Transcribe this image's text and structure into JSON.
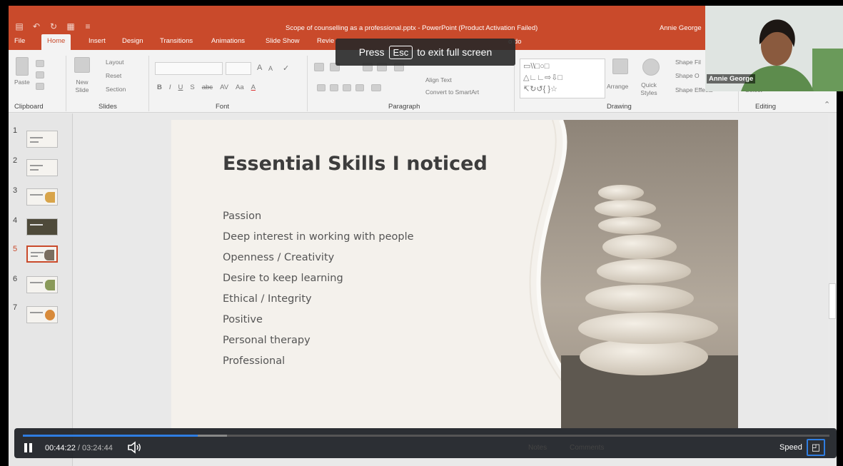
{
  "window": {
    "title": "Scope of counselling as a professional.pptx  -  PowerPoint (Product Activation Failed)",
    "user": "Annie George"
  },
  "tabs": [
    "File",
    "Home",
    "Insert",
    "Design",
    "Transitions",
    "Animations",
    "Slide Show",
    "Revie"
  ],
  "active_tab": "Home",
  "tell_me_fragment": "o do",
  "ribbon": {
    "groups": [
      "Clipboard",
      "Slides",
      "Font",
      "Paragraph",
      "Drawing",
      "Editing"
    ],
    "clipboard": {
      "paste": "Paste"
    },
    "slides": {
      "new_slide": "New Slide",
      "layout": "Layout",
      "reset": "Reset",
      "section": "Section"
    },
    "font": {
      "grow": "A",
      "shrink": "A",
      "case": "Aa",
      "color": "A",
      "format_marks": [
        "B",
        "I",
        "U",
        "S",
        "abc",
        "AV"
      ]
    },
    "paragraph": {
      "align_text": "Align Text",
      "convert_smartart": "Convert to SmartArt"
    },
    "drawing": {
      "arrange": "Arrange",
      "quick_styles": "Quick Styles",
      "shape_fill": "Shape Fil",
      "shape_outline": "Shape O",
      "shape_effects": "Shape Effects"
    },
    "editing": {
      "select": "Select"
    }
  },
  "esc_banner": {
    "press": "Press",
    "key": "Esc",
    "rest": "to exit full screen"
  },
  "thumbnails": [
    {
      "num": "1"
    },
    {
      "num": "2"
    },
    {
      "num": "3"
    },
    {
      "num": "4"
    },
    {
      "num": "5",
      "selected": true
    },
    {
      "num": "6"
    },
    {
      "num": "7"
    }
  ],
  "slide": {
    "title": "Essential Skills I noticed",
    "bullets": [
      "Passion",
      "Deep interest in working with people",
      "Openness / Creativity",
      "Desire to keep learning",
      "Ethical / Integrity",
      "Positive",
      "Personal therapy",
      "Professional"
    ]
  },
  "webcam": {
    "name": "Annie George"
  },
  "player": {
    "current_time": "00:44:22",
    "total_time": "03:24:44",
    "progress": 0.217,
    "buffered_until": 0.253,
    "speed_label": "Speed",
    "status_ghost": [
      "Notes",
      "Comments"
    ]
  },
  "colors": {
    "accent": "#c94a2b",
    "player_accent": "#2f7de1"
  }
}
